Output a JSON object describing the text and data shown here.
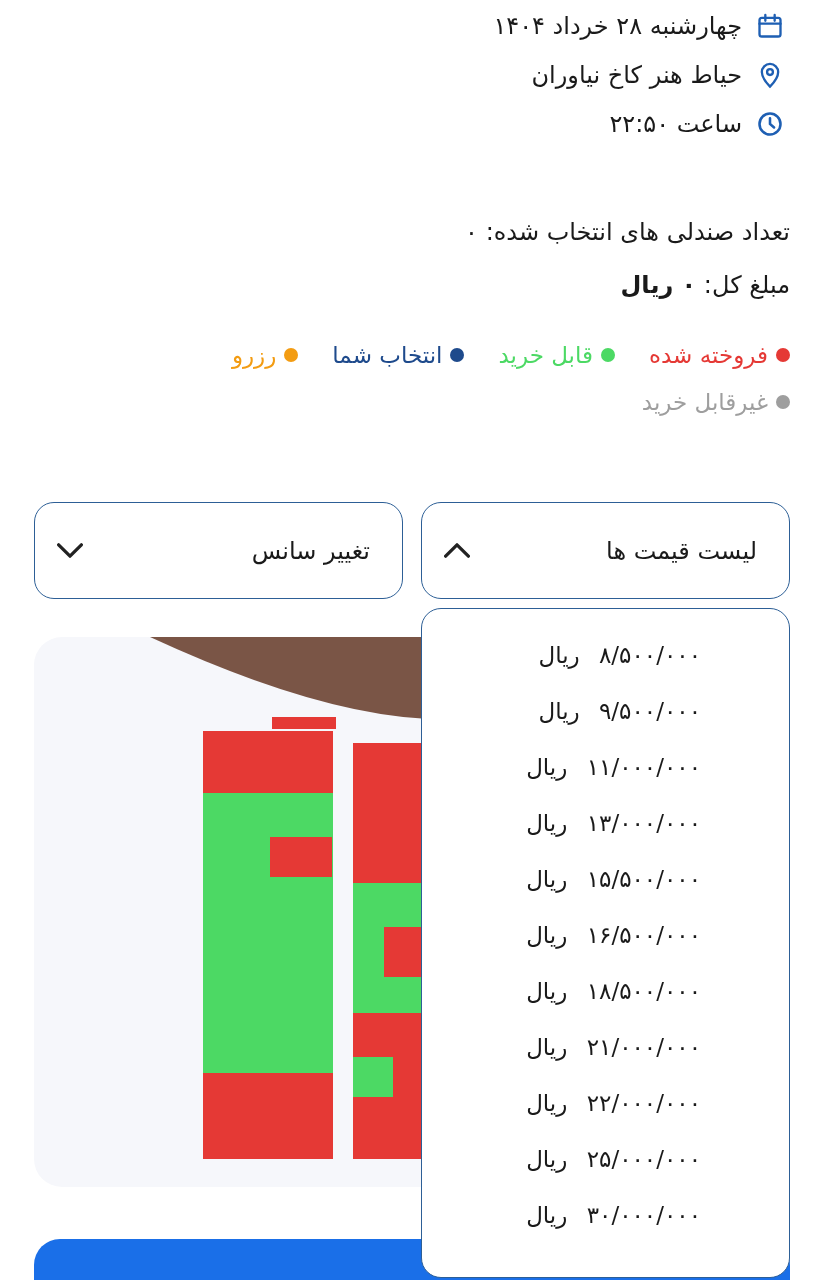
{
  "info": [
    {
      "kind": "date",
      "text": "چهارشنبه ۲۸ خرداد ۱۴۰۴"
    },
    {
      "kind": "location",
      "text": "حیاط هنر کاخ نیاوران"
    },
    {
      "kind": "time",
      "text": "ساعت ۲۲:۵۰"
    }
  ],
  "summary": {
    "selected_count": "تعداد صندلی های انتخاب شده: ۰",
    "total": "مبلغ کل: **۰ ریال**"
  },
  "legend": [
    {
      "label": "فروخته شده",
      "color": "#e53935"
    },
    {
      "label": "قابل خرید",
      "color": "#4cd964"
    },
    {
      "label": "انتخاب شما",
      "color": "#1e4a8c"
    },
    {
      "label": "رزرو",
      "color": "#f39c12"
    },
    {
      "label": "غیرقابل خرید",
      "color": "#9e9e9e"
    }
  ],
  "dropdowns": [
    {
      "label": "لیست قیمت ها",
      "expanded": true,
      "options": [
        "۸/۵۰۰/۰۰۰ ریال",
        "۹/۵۰۰/۰۰۰ ریال",
        "۱۱/۰۰۰/۰۰۰ ریال",
        "۱۳/۰۰۰/۰۰۰ ریال",
        "۱۵/۵۰۰/۰۰۰ ریال",
        "۱۶/۵۰۰/۰۰۰ ریال",
        "۱۸/۵۰۰/۰۰۰ ریال",
        "۲۱/۰۰۰/۰۰۰ ریال",
        "۲۲/۰۰۰/۰۰۰ ریال",
        "۲۵/۰۰۰/۰۰۰ ریال",
        "۳۰/۰۰۰/۰۰۰ ریال"
      ]
    },
    {
      "label": "تغییر سانس",
      "expanded": false
    }
  ]
}
